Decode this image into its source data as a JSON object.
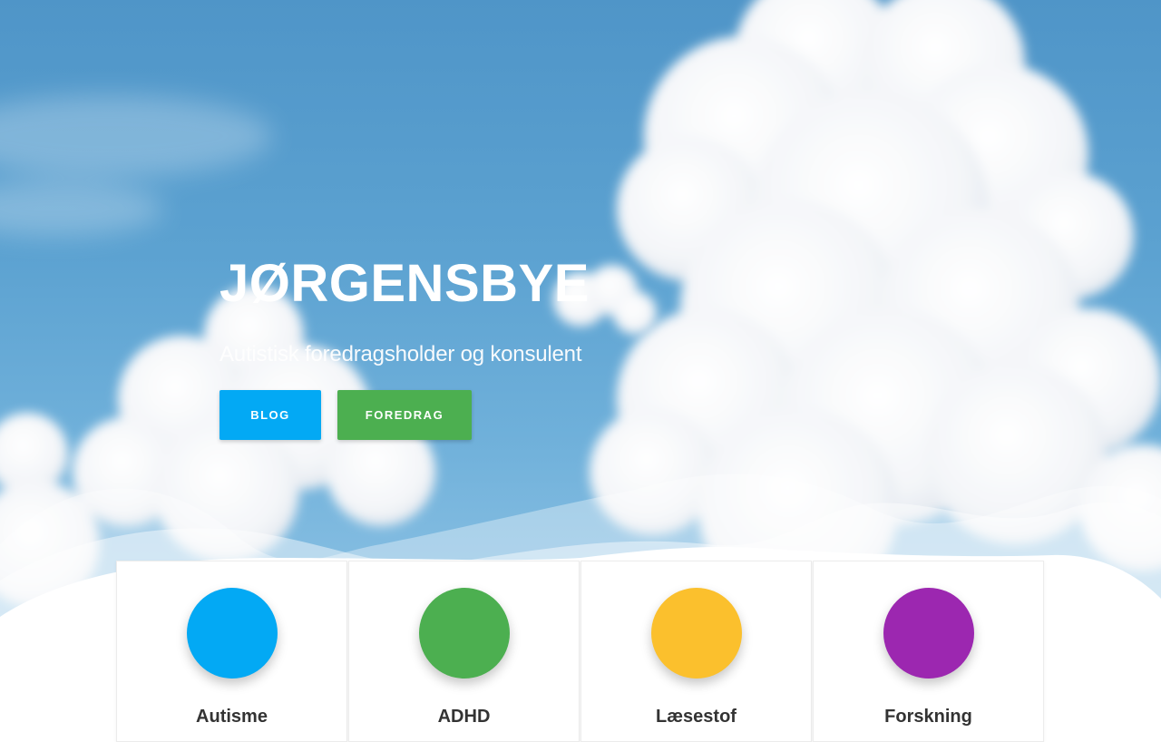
{
  "hero": {
    "title": "JØRGENSBYE",
    "subtitle": "Autistisk foredragsholder og konsulent",
    "buttons": [
      {
        "label": "BLOG",
        "color": "#03a9f4"
      },
      {
        "label": "FOREDRAG",
        "color": "#4caf50"
      }
    ]
  },
  "cards": [
    {
      "title": "Autisme",
      "color": "#03a9f4"
    },
    {
      "title": "ADHD",
      "color": "#4caf50"
    },
    {
      "title": "Læsestof",
      "color": "#fbc02d"
    },
    {
      "title": "Forskning",
      "color": "#9c27b0"
    }
  ]
}
